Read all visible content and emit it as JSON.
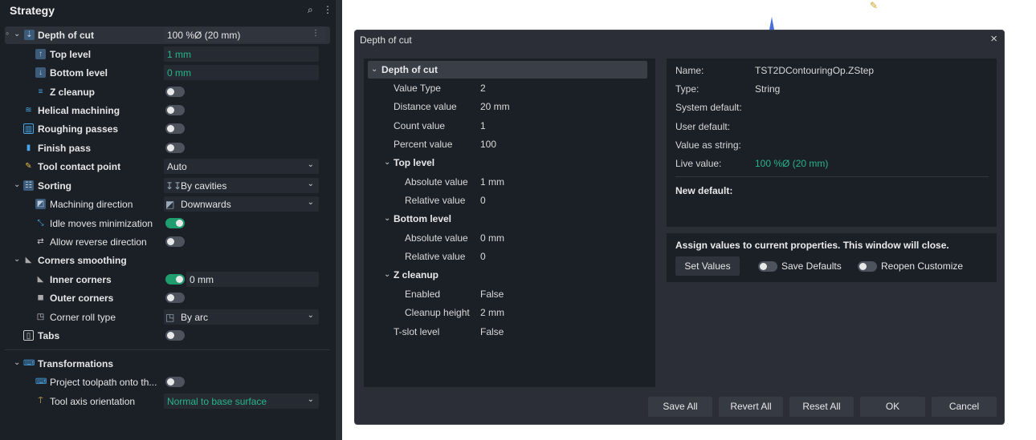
{
  "panel": {
    "title": "Strategy",
    "rows": [
      {
        "label": "Depth of cut",
        "value": "100 %Ø (20 mm)"
      },
      {
        "label": "Top level",
        "value": "1 mm"
      },
      {
        "label": "Bottom level",
        "value": "0 mm"
      },
      {
        "label": "Z cleanup"
      },
      {
        "label": "Helical machining"
      },
      {
        "label": "Roughing passes"
      },
      {
        "label": "Finish pass"
      },
      {
        "label": "Tool contact point",
        "value": "Auto"
      },
      {
        "label": "Sorting",
        "value": "By cavities"
      },
      {
        "label": "Machining direction",
        "value": "Downwards"
      },
      {
        "label": "Idle moves minimization"
      },
      {
        "label": "Allow reverse direction"
      },
      {
        "label": "Corners smoothing"
      },
      {
        "label": "Inner corners",
        "value": "0 mm"
      },
      {
        "label": "Outer corners"
      },
      {
        "label": "Corner roll type",
        "value": "By arc"
      },
      {
        "label": "Tabs"
      },
      {
        "label": "Transformations"
      },
      {
        "label": "Project toolpath onto th..."
      },
      {
        "label": "Tool axis orientation",
        "value": "Normal to base surface"
      }
    ]
  },
  "dialog": {
    "title": "Depth of cut",
    "close": "×",
    "tree": [
      {
        "key": "Depth of cut",
        "val": ""
      },
      {
        "key": "Value Type",
        "val": "2"
      },
      {
        "key": "Distance value",
        "val": "20 mm"
      },
      {
        "key": "Count value",
        "val": "1"
      },
      {
        "key": "Percent value",
        "val": "100"
      },
      {
        "key": "Top level",
        "val": ""
      },
      {
        "key": "Absolute value",
        "val": "1 mm"
      },
      {
        "key": "Relative value",
        "val": "0"
      },
      {
        "key": "Bottom level",
        "val": ""
      },
      {
        "key": "Absolute value",
        "val": "0 mm"
      },
      {
        "key": "Relative value",
        "val": "0"
      },
      {
        "key": "Z cleanup",
        "val": ""
      },
      {
        "key": "Enabled",
        "val": "False"
      },
      {
        "key": "Cleanup height",
        "val": "2 mm"
      },
      {
        "key": "T-slot level",
        "val": "False"
      }
    ],
    "info": [
      {
        "key": "Name:",
        "val": "TST2DContouringOp.ZStep"
      },
      {
        "key": "Type:",
        "val": "String"
      },
      {
        "key": "System default:",
        "val": ""
      },
      {
        "key": "User default:",
        "val": ""
      },
      {
        "key": "Value as string:",
        "val": ""
      },
      {
        "key": "Live value:",
        "val": "100 %Ø (20 mm)"
      }
    ],
    "new_default": "New default:",
    "assign_text": "Assign values to current properties. This window will close.",
    "set_values": "Set Values",
    "save_defaults": "Save Defaults",
    "reopen_customize": "Reopen Customize",
    "buttons": {
      "save_all": "Save All",
      "revert_all": "Revert All",
      "reset_all": "Reset All",
      "ok": "OK",
      "cancel": "Cancel"
    }
  }
}
